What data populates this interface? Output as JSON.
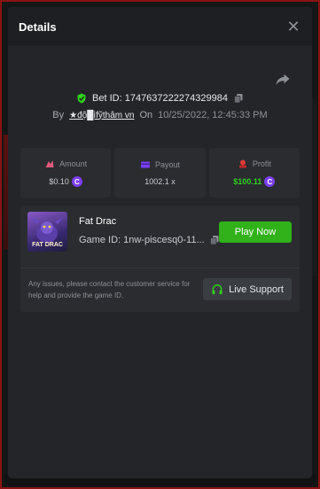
{
  "modal": {
    "title": "Details"
  },
  "bet": {
    "id_label": "Bet ID: 1747637222274329984",
    "by_label": "By",
    "username": "★độ█ìfỹthâm vn",
    "on_label": "On",
    "date": "10/25/2022, 12:45:33 PM"
  },
  "stats": {
    "amount": {
      "label": "Amount",
      "value": "$0.10",
      "color": "#e05a7a"
    },
    "payout": {
      "label": "Payout",
      "value": "1002.1 x",
      "color": "#7b3ff2"
    },
    "profit": {
      "label": "Profit",
      "value": "$100.11",
      "color": "#30d21c"
    }
  },
  "game": {
    "name": "Fat Drac",
    "thumb_text": "FAT DRAC",
    "id_label": "Game ID: 1nw-piscesq0-11...",
    "play_label": "Play Now",
    "support_text": "Any issues, please contact the customer service for help and provide the game ID.",
    "support_label": "Live Support"
  },
  "icons": {
    "shield": "shield-check-icon",
    "copy": "copy-icon",
    "share": "share-icon",
    "close": "close-icon",
    "headset": "headset-icon",
    "coin": "coin-icon"
  },
  "colors": {
    "accent_green": "#31b21a",
    "profit_green": "#30d21c",
    "coin_purple": "#7b3ff2"
  }
}
